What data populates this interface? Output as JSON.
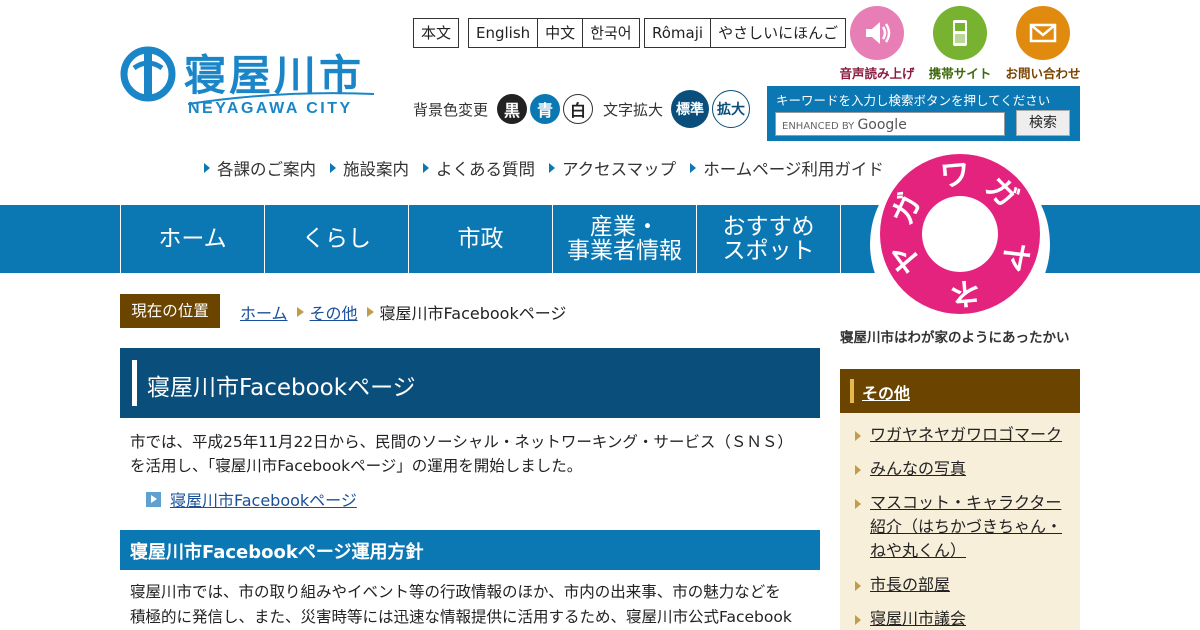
{
  "header": {
    "logo": {
      "name_ja": "寝屋川市",
      "name_en": "NEYAGAWA CITY"
    },
    "language_links": [
      [
        "本文"
      ],
      [
        "English",
        "中文",
        "한국어"
      ],
      [
        "Rômaji",
        "やさしいにほんご"
      ]
    ],
    "top_icons": [
      {
        "label": "音声読み上げ",
        "icon": "speaker-icon",
        "color": "#e77fb6",
        "label_color": "#8a1b3f"
      },
      {
        "label": "携帯サイト",
        "icon": "mobile-phone-icon",
        "color": "#77b230",
        "label_color": "#3f6b10"
      },
      {
        "label": "お問い合わせ",
        "icon": "mail-icon",
        "color": "#e08a10",
        "label_color": "#7a4400"
      }
    ],
    "bg_color_label": "背景色変更",
    "bg_color_buttons": [
      "黒",
      "青",
      "白"
    ],
    "font_size_label": "文字拡大",
    "font_size_buttons": [
      "標準",
      "拡大"
    ],
    "search": {
      "hint": "キーワードを入力し検索ボタンを押してください",
      "placeholder_small": "ENHANCED BY",
      "placeholder_brand": "Google",
      "button": "検索"
    },
    "sub_links": [
      "各課のご案内",
      "施設案内",
      "よくある質問",
      "アクセスマップ",
      "ホームページ利用ガイド"
    ]
  },
  "global_nav": [
    {
      "label": "ホーム"
    },
    {
      "label": "くらし"
    },
    {
      "label": "市政"
    },
    {
      "label": "産業・\n事業者情報"
    },
    {
      "label": "おすすめ\nスポット"
    }
  ],
  "badge": {
    "ring_chars": [
      "ワ",
      "ガ",
      "ヤ",
      "ネ",
      "ヤ",
      "ガ"
    ],
    "caption": "寝屋川市はわが家のようにあったかい"
  },
  "breadcrumb": {
    "label": "現在の位置",
    "items": [
      "ホーム",
      "その他"
    ],
    "current": "寝屋川市Facebookページ"
  },
  "main": {
    "title": "寝屋川市Facebookページ",
    "intro_line1": "市では、平成25年11月22日から、民間のソーシャル・ネットワーキング・サービス（ＳＮＳ）",
    "intro_line2": "を活用し、「寝屋川市Facebookページ」の運用を開始しました。",
    "link": "寝屋川市Facebookページ",
    "section_title": "寝屋川市Facebookページ運用方針",
    "section_line1": "寝屋川市では、市の取り組みやイベント等の行政情報のほか、市内の出来事、市の魅力などを",
    "section_line2": "積極的に発信し、また、災害時等には迅速な情報提供に活用するため、寝屋川市公式Facebook"
  },
  "sidebar": {
    "heading": "その他",
    "items": [
      "ワガヤネヤガワロゴマーク",
      "みんなの写真",
      "マスコット・キャラクター紹介（はちかづきちゃん・ねや丸くん）",
      "市長の部屋",
      "寝屋川市議会"
    ]
  }
}
